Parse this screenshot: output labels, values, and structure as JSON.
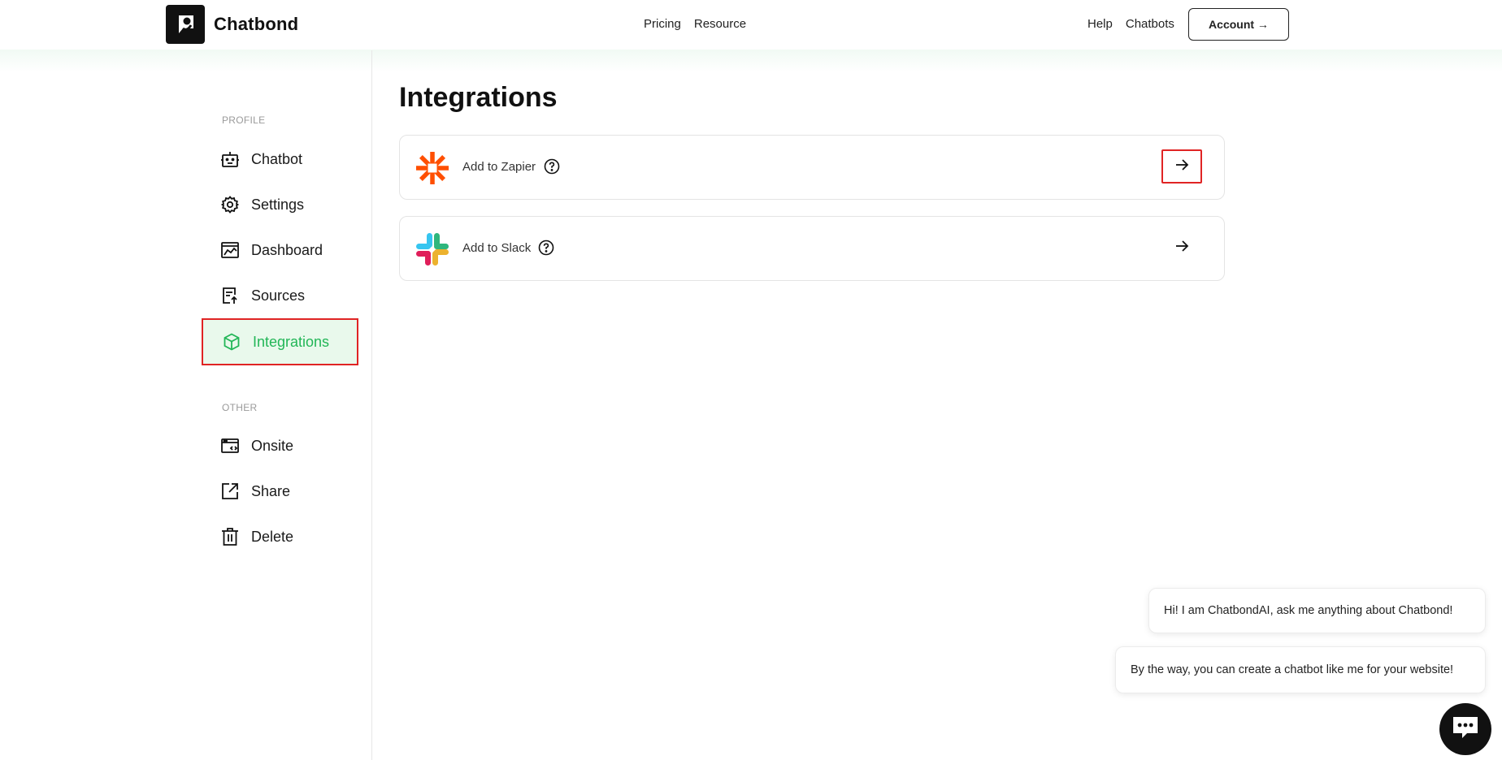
{
  "header": {
    "brand": "Chatbond",
    "nav_center": [
      "Pricing",
      "Resource"
    ],
    "nav_right": [
      "Help",
      "Chatbots"
    ],
    "account_label": "Account →"
  },
  "sidebar": {
    "profile_label": "PROFILE",
    "other_label": "OTHER",
    "profile_items": [
      {
        "label": "Chatbot",
        "icon": "robot-icon"
      },
      {
        "label": "Settings",
        "icon": "gear-icon"
      },
      {
        "label": "Dashboard",
        "icon": "chart-icon"
      },
      {
        "label": "Sources",
        "icon": "document-upload-icon"
      },
      {
        "label": "Integrations",
        "icon": "cube-icon",
        "active": true
      }
    ],
    "other_items": [
      {
        "label": "Onsite",
        "icon": "browser-code-icon"
      },
      {
        "label": "Share",
        "icon": "share-external-icon"
      },
      {
        "label": "Delete",
        "icon": "trash-icon"
      }
    ]
  },
  "main": {
    "title": "Integrations",
    "integrations": [
      {
        "label": "Add to Zapier",
        "icon": "zapier-logo-icon"
      },
      {
        "label": "Add to Slack",
        "icon": "slack-logo-icon"
      }
    ]
  },
  "chat": {
    "messages": [
      "Hi! I am ChatbondAI, ask me anything about Chatbond!",
      "By the way, you can create a chatbot like me for your website!"
    ]
  },
  "colors": {
    "accent_green": "#22b657",
    "active_bg": "#e9f9ec",
    "highlight_red": "#e02424",
    "zapier_orange": "#ff4f00"
  }
}
